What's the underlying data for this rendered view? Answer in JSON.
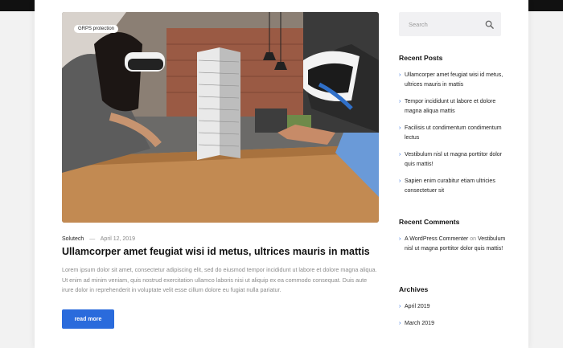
{
  "hero": {
    "badge": "GRPS protection"
  },
  "post": {
    "author": "Solutech",
    "separator": "—",
    "date": "April 12, 2019",
    "title": "Ullamcorper amet feugiat wisi id metus, ultrices mauris in mattis",
    "excerpt": "Lorem ipsum dolor sit amet, consectetur adipiscing elit, sed do eiusmod tempor incididunt ut labore et dolore magna aliqua. Ut enim ad minim veniam, quis nostrud exercitation ullamco laboris nisi ut aliquip ex ea commodo consequat. Duis aute irure dolor in reprehenderit in voluptate velit esse cillum dolore eu fugiat nulla pariatur.",
    "read_more": "read more"
  },
  "sidebar": {
    "search_placeholder": "Search",
    "recent_posts_title": "Recent Posts",
    "recent_posts": [
      "Ullamcorper amet feugiat wisi id metus, ultrices mauris in mattis",
      "Tempor incididunt ut labore et dolore magna aliqua mattis",
      "Facilisis ut condimentum condimentum lectus",
      "Vestibulum nisl ut magna porttitor dolor quis mattis!",
      "Sapien enim curabitur etiam ultricies consectetuer sit"
    ],
    "recent_comments_title": "Recent Comments",
    "comment": {
      "author": "A WordPress Commenter",
      "on": "on",
      "post": "Vestibulum nisl ut magna porttitor dolor quis mattis!"
    },
    "archives_title": "Archives",
    "archives": [
      "April 2019",
      "March 2019"
    ]
  },
  "colors": {
    "accent": "#2a6bdc"
  }
}
